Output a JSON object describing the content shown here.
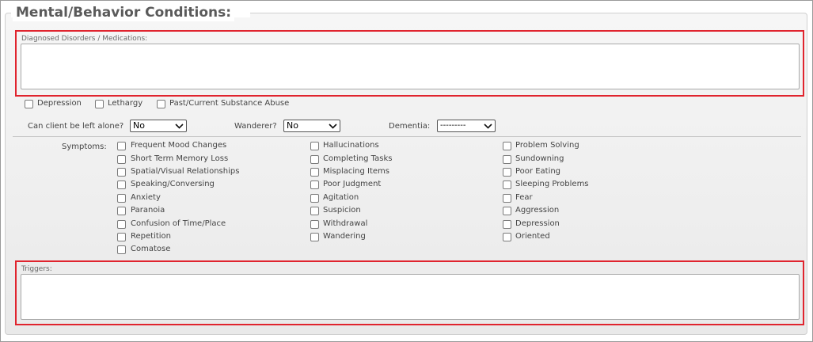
{
  "section": {
    "title": "Mental/Behavior Conditions:"
  },
  "diagnosed": {
    "label": "Diagnosed Disorders / Medications:",
    "value": ""
  },
  "conditions": [
    {
      "label": "Depression",
      "checked": false
    },
    {
      "label": "Lethargy",
      "checked": false
    },
    {
      "label": "Past/Current Substance Abuse",
      "checked": false
    }
  ],
  "selects": {
    "alone": {
      "label": "Can client be left alone?",
      "value": "No"
    },
    "wanderer": {
      "label": "Wanderer?",
      "value": "No"
    },
    "dementia": {
      "label": "Dementia:",
      "value": "---------"
    }
  },
  "symptoms": {
    "label": "Symptoms:",
    "col1": [
      "Frequent Mood Changes",
      "Short Term Memory Loss",
      "Spatial/Visual Relationships",
      "Speaking/Conversing",
      "Anxiety",
      "Paranoia",
      "Confusion of Time/Place",
      "Repetition",
      "Comatose"
    ],
    "col2": [
      "Hallucinations",
      "Completing Tasks",
      "Misplacing Items",
      "Poor Judgment",
      "Agitation",
      "Suspicion",
      "Withdrawal",
      "Wandering"
    ],
    "col3": [
      "Problem Solving",
      "Sundowning",
      "Poor Eating",
      "Sleeping Problems",
      "Fear",
      "Aggression",
      "Depression",
      "Oriented"
    ]
  },
  "triggers": {
    "label": "Triggers:",
    "value": ""
  },
  "colors": {
    "highlight": "#e0242e",
    "panel": "#efefef"
  }
}
